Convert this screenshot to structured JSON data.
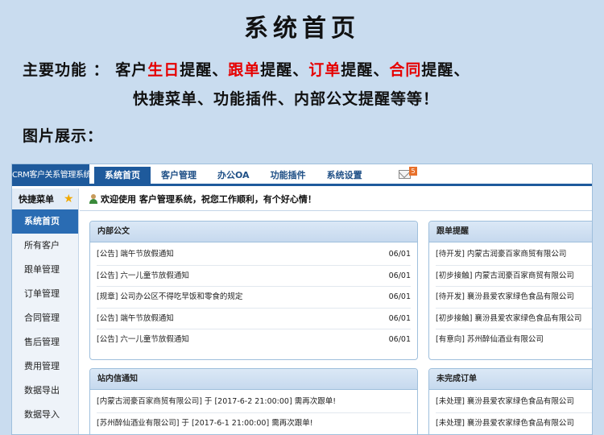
{
  "heading": "系统首页",
  "intro": {
    "prefix": "主要功能 ： 客户",
    "birthday": "生日",
    "reminder1": "提醒、",
    "followup": "跟单",
    "reminder2": "提醒、",
    "order": "订单",
    "reminder3": "提醒、",
    "contract": "合同",
    "reminder4": "提醒、",
    "line2": "快捷菜单、功能插件、内部公文提醒等等！",
    "line3": "图片展示："
  },
  "app": {
    "brand": "CRM客户关系管理系统",
    "tabs": [
      "系统首页",
      "客户管理",
      "办公OA",
      "功能插件",
      "系统设置"
    ],
    "mail_count": "5",
    "sidebar": {
      "title": "快捷菜单",
      "items": [
        "系统首页",
        "所有客户",
        "跟单管理",
        "订单管理",
        "合同管理",
        "售后管理",
        "费用管理",
        "数据导出",
        "数据导入"
      ]
    },
    "welcome": "欢迎使用 客户管理系统，祝您工作顺利，有个好心情！",
    "panels": {
      "docs": {
        "title": "内部公文",
        "rows": [
          {
            "text": "[公告] 端午节放假通知",
            "date": "06/01"
          },
          {
            "text": "[公告] 六一儿童节放假通知",
            "date": "06/01"
          },
          {
            "text": "[规章] 公司办公区不得吃早饭和零食的规定",
            "date": "06/01"
          },
          {
            "text": "[公告] 端午节放假通知",
            "date": "06/01"
          },
          {
            "text": "[公告] 六一儿童节放假通知",
            "date": "06/01"
          }
        ]
      },
      "followups": {
        "title": "跟单提醒",
        "rows": [
          "[待开发] 内蒙古润豪百家商贸有限公司",
          "[初步接触] 内蒙古润豪百家商贸有限公司",
          "[待开发] 襄汾县爱农家绿色食品有限公司",
          "[初步接触] 襄汾县爱农家绿色食品有限公司",
          "[有意向] 苏州醉仙酒业有限公司"
        ]
      },
      "messages": {
        "title": "站内信通知",
        "rows": [
          "[内蒙古润豪百家商贸有限公司] 于 [2017-6-2 21:00:00] 需再次跟单!",
          "[苏州醉仙酒业有限公司] 于 [2017-6-1 21:00:00] 需再次跟单!"
        ]
      },
      "pending": {
        "title": "未完成订单",
        "rows": [
          "[未处理] 襄汾县爱农家绿色食品有限公司",
          "[未处理] 襄汾县爱农家绿色食品有限公司"
        ]
      }
    }
  }
}
